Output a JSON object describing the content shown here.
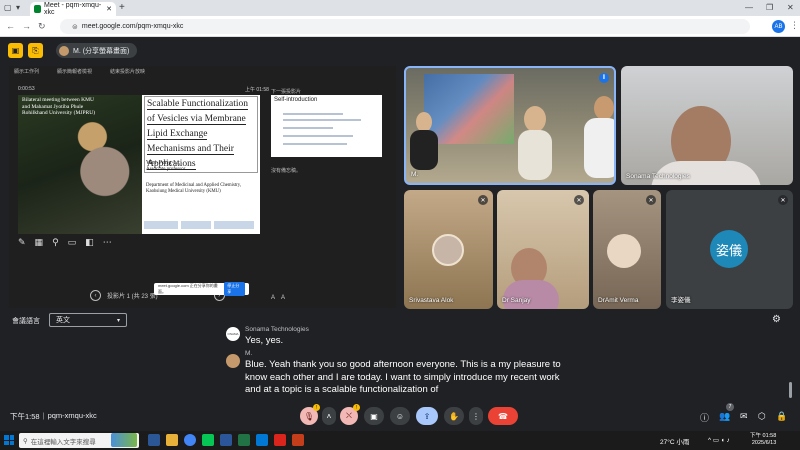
{
  "browser": {
    "tab_title": "Meet - pqm-xmqu-xkc",
    "url": "meet.google.com/pqm-xmqu-xkc",
    "profile_initials": "AB"
  },
  "meet": {
    "presenter_chip": "M. (分享螢幕畫面)"
  },
  "presentation": {
    "toolbar_items": [
      "顯示工作列",
      "顯示簡報者檢視",
      "結束投影片放映"
    ],
    "timer": "0:00:53",
    "clock": "上午 01:58",
    "slide": {
      "image_caption": "Bilateral meeting between KMU and Mahamat Jyotiba Phule Rohilkhand University (MJPRU)",
      "title": "Scalable Functionalization of Vesicles via Membrane Lipid Exchange Mechanisms and Their Applications",
      "author": "Wei-Peng Li,",
      "position": "Associate professor",
      "department": "Department of Medicinal and Applied Chemistry, Kaohsiung Medical University (KMU)"
    },
    "next_label": "下一張投影片",
    "next_title": "Self-introduction",
    "notes_label": "沒有備忘稿。",
    "slide_counter": "投影片 1 (共 23 張)",
    "popup_text": "meet.google.com 正在分享你的畫面。",
    "popup_button": "停止分享"
  },
  "participants": [
    {
      "name": "M.",
      "state": "speaking"
    },
    {
      "name": "Sonama Technologies",
      "state": ""
    },
    {
      "name": "Srivastava Alok",
      "state": "muted"
    },
    {
      "name": "Dr Sanjay",
      "state": "muted"
    },
    {
      "name": "DrAmit Verma",
      "state": "muted"
    },
    {
      "name": "李姿儀",
      "state": "muted",
      "avatar_text": "姿儀"
    }
  ],
  "captions": {
    "lang_label": "會議語言",
    "lang_value": "英文",
    "entries": [
      {
        "speaker": "Sonama Technologies",
        "text": "Yes, yes.",
        "avatar_text": "ONAMA"
      },
      {
        "speaker": "M.",
        "text": "Blue. Yeah thank you so good afternoon everyone. This is a my pleasure to know each other and I are today. I want to simply introduce my recent work and at a topic is a scalable functionalization of"
      }
    ]
  },
  "footer": {
    "time": "下午1:58",
    "meeting_code": "pqm-xmqu-xkc",
    "people_count": "7"
  },
  "taskbar": {
    "search_placeholder": "在這裡輸入文字來搜尋",
    "weather": "27°C 小雨",
    "clock_time": "下午 01:58",
    "clock_date": "2025/6/13"
  },
  "colors": {
    "meet_bg": "#202124",
    "tile_bg": "#3c4043",
    "end_call": "#ea4335",
    "accent_blue": "#8ab4f8",
    "warn_yellow": "#fbbc04"
  }
}
